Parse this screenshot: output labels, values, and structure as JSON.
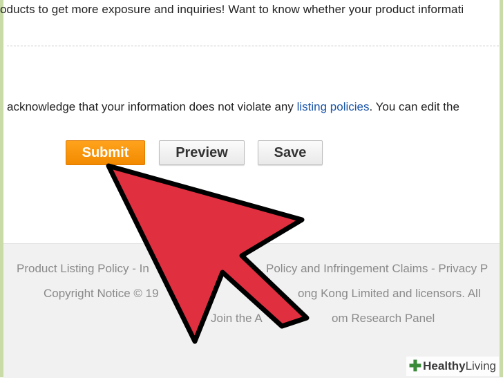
{
  "page": {
    "top_text": "oducts to get more exposure and inquiries! Want to know whether your product informati",
    "ack_text_before": "acknowledge that your information does not violate any ",
    "ack_link": "listing policies",
    "ack_text_after": ". You can edit the"
  },
  "buttons": {
    "submit_label": "Submit",
    "preview_label": "Preview",
    "save_label": "Save"
  },
  "footer": {
    "line1_left": "Product Listing Policy - In",
    "line1_right": "Policy and Infringement Claims - Privacy P",
    "line2_left": "Copyright Notice © 19",
    "line2_right": "ong Kong Limited and licensors. All",
    "line3_left": "Join the A",
    "line3_right": "om Research Panel"
  },
  "overlay": {
    "arrow_color": "#e03040",
    "watermark_brand": "Healthy",
    "watermark_suffix": "Living"
  }
}
